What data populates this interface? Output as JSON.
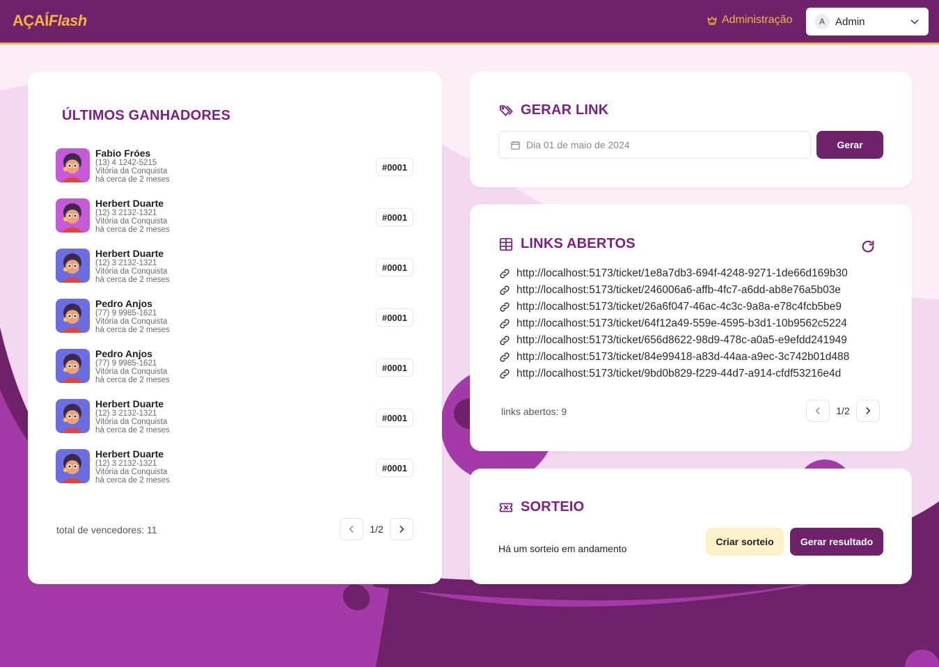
{
  "header": {
    "logo": "AÇAÍFlash",
    "logo_part1": "AÇAÍ",
    "logo_part2": "Flash",
    "admin_link": "Administração",
    "user": {
      "initial": "A",
      "name": "Admin"
    }
  },
  "winners": {
    "title": "ÚLTIMOS GANHADORES",
    "items": [
      {
        "name": "Fabio Fróes",
        "phone": "(13) 4 1242-5215",
        "city": "Vitória da Conquista",
        "time": "há cerca de 2 meses",
        "badge": "#0001",
        "avatar": "pink"
      },
      {
        "name": "Herbert Duarte",
        "phone": "(12) 3 2132-1321",
        "city": "Vitória da Conquista",
        "time": "há cerca de 2 meses",
        "badge": "#0001",
        "avatar": "pink"
      },
      {
        "name": "Herbert Duarte",
        "phone": "(12) 3 2132-1321",
        "city": "Vitória da Conquista",
        "time": "há cerca de 2 meses",
        "badge": "#0001",
        "avatar": "blue"
      },
      {
        "name": "Pedro Anjos",
        "phone": "(77) 9 9985-1621",
        "city": "Vitória da Conquista",
        "time": "há cerca de 2 meses",
        "badge": "#0001",
        "avatar": "blue"
      },
      {
        "name": "Pedro Anjos",
        "phone": "(77) 9 9985-1621",
        "city": "Vitória da Conquista",
        "time": "há cerca de 2 meses",
        "badge": "#0001",
        "avatar": "blue"
      },
      {
        "name": "Herbert Duarte",
        "phone": "(12) 3 2132-1321",
        "city": "Vitória da Conquista",
        "time": "há cerca de 2 meses",
        "badge": "#0001",
        "avatar": "blue"
      },
      {
        "name": "Herbert Duarte",
        "phone": "(12) 3 2132-1321",
        "city": "Vitória da Conquista",
        "time": "há cerca de 2 meses",
        "badge": "#0001",
        "avatar": "blue"
      }
    ],
    "total": "total de vencedores: 11",
    "page": "1/2"
  },
  "gerar_link": {
    "title": "GERAR LINK",
    "date_placeholder": "Dia 01 de maio de 2024",
    "button": "Gerar"
  },
  "links_abertos": {
    "title": "LINKS ABERTOS",
    "links": [
      "http://localhost:5173/ticket/1e8a7db3-694f-4248-9271-1de66d169b30",
      "http://localhost:5173/ticket/246006a6-affb-4fc7-a6dd-ab8e76a5b03e",
      "http://localhost:5173/ticket/26a6f047-46ac-4c3c-9a8a-e78c4fcb5be9",
      "http://localhost:5173/ticket/64f12a49-559e-4595-b3d1-10b9562c5224",
      "http://localhost:5173/ticket/656d8622-98d9-478c-a0a5-e9efdd241949",
      "http://localhost:5173/ticket/84e99418-a83d-44aa-a9ec-3c742b01d488",
      "http://localhost:5173/ticket/9bd0b829-f229-44d7-a914-cfdf53216e4d"
    ],
    "count": "links abertos: 9",
    "page": "1/2"
  },
  "sorteio": {
    "title": "SORTEIO",
    "status": "Há um sorteio em andamento",
    "create_button": "Criar sorteio",
    "result_button": "Gerar resultado"
  },
  "colors": {
    "primary": "#6f2169",
    "accent": "#f4b53f",
    "title": "#7d1f85"
  }
}
